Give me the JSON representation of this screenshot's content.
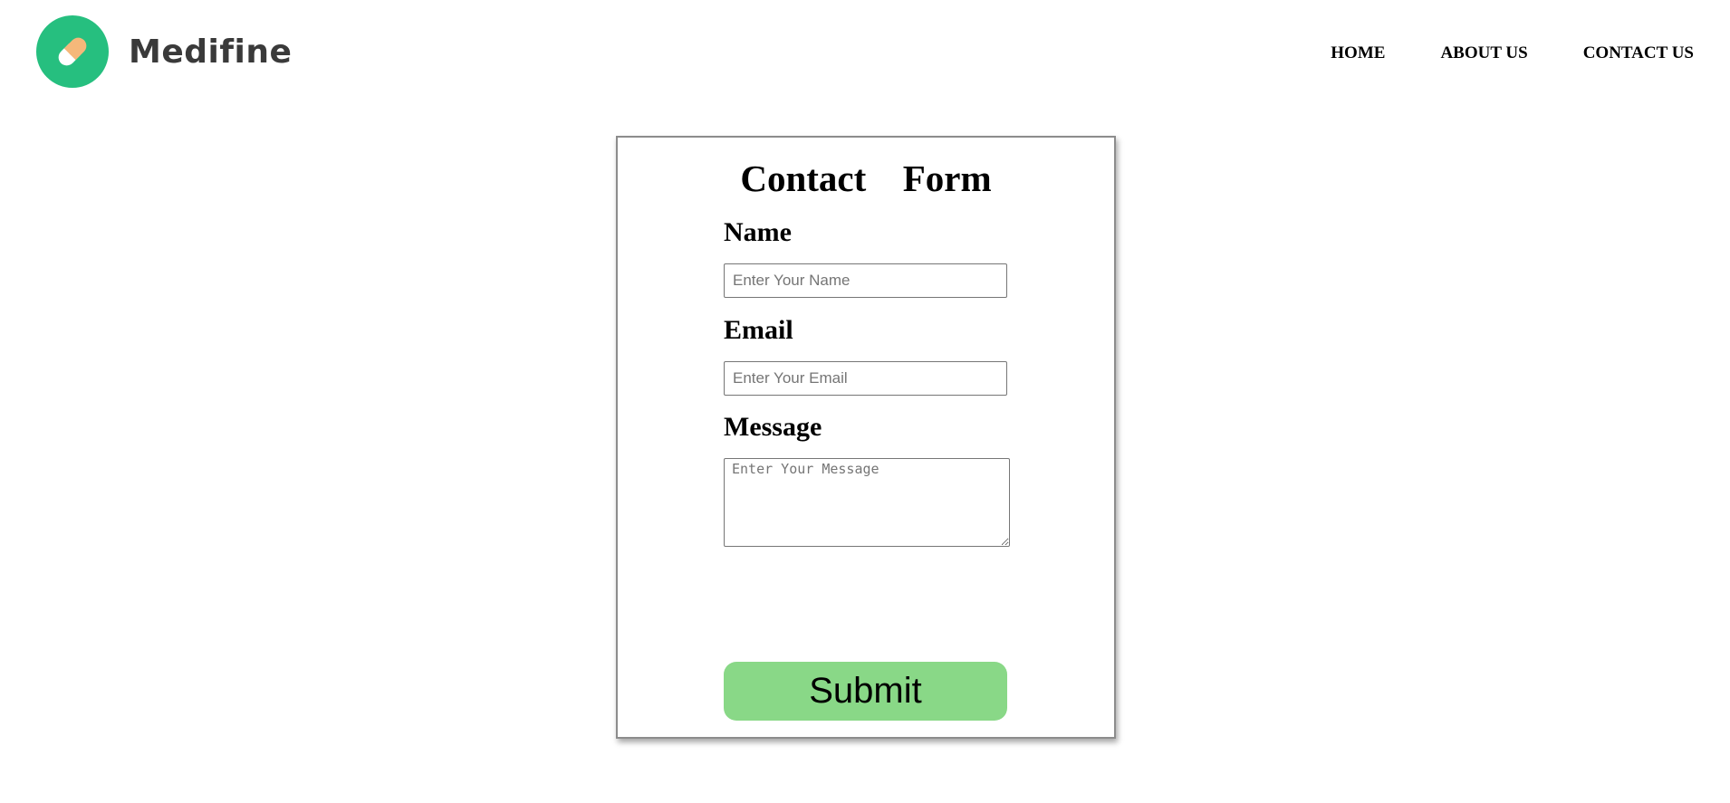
{
  "brand": {
    "name": "Medifine",
    "logo_icon": "pill-icon",
    "logo_color": "#26bf7f",
    "pill_white": "#ffffff",
    "pill_orange": "#f5b87a"
  },
  "nav": {
    "items": [
      {
        "label": "HOME"
      },
      {
        "label": "ABOUT US"
      },
      {
        "label": "CONTACT US"
      }
    ]
  },
  "form": {
    "title": "Contact  Form",
    "name_label": "Name",
    "name_placeholder": "Enter Your Name",
    "email_label": "Email",
    "email_placeholder": "Enter Your Email",
    "message_label": "Message",
    "message_placeholder": "Enter Your Message",
    "submit_label": "Submit",
    "submit_color": "#89d887"
  }
}
